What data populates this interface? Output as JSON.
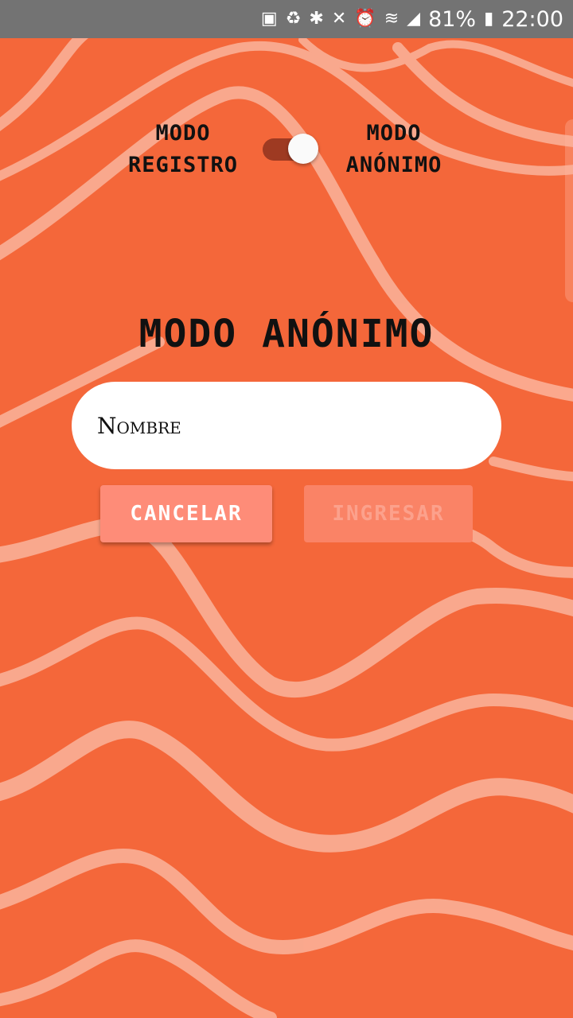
{
  "status_bar": {
    "battery_percent": "81%",
    "time": "22:00",
    "icons": [
      "battery-saver-icon",
      "recycle-icon",
      "bluetooth-icon",
      "mute-icon",
      "alarm-icon",
      "wifi-icon",
      "signal-icon",
      "battery-charging-icon"
    ]
  },
  "mode_toggle": {
    "left_label": "Modo Registro",
    "right_label": "Modo Anónimo",
    "checked": true
  },
  "form": {
    "title": "Modo Anónimo",
    "name_placeholder": "Nombre",
    "cancel_label": "Cancelar",
    "enter_label": "Ingresar"
  },
  "colors": {
    "background": "#f4673a",
    "stripe": "#fbb49c",
    "cancel_button": "#fe8c78",
    "enter_button_disabled": "#fa8366"
  }
}
